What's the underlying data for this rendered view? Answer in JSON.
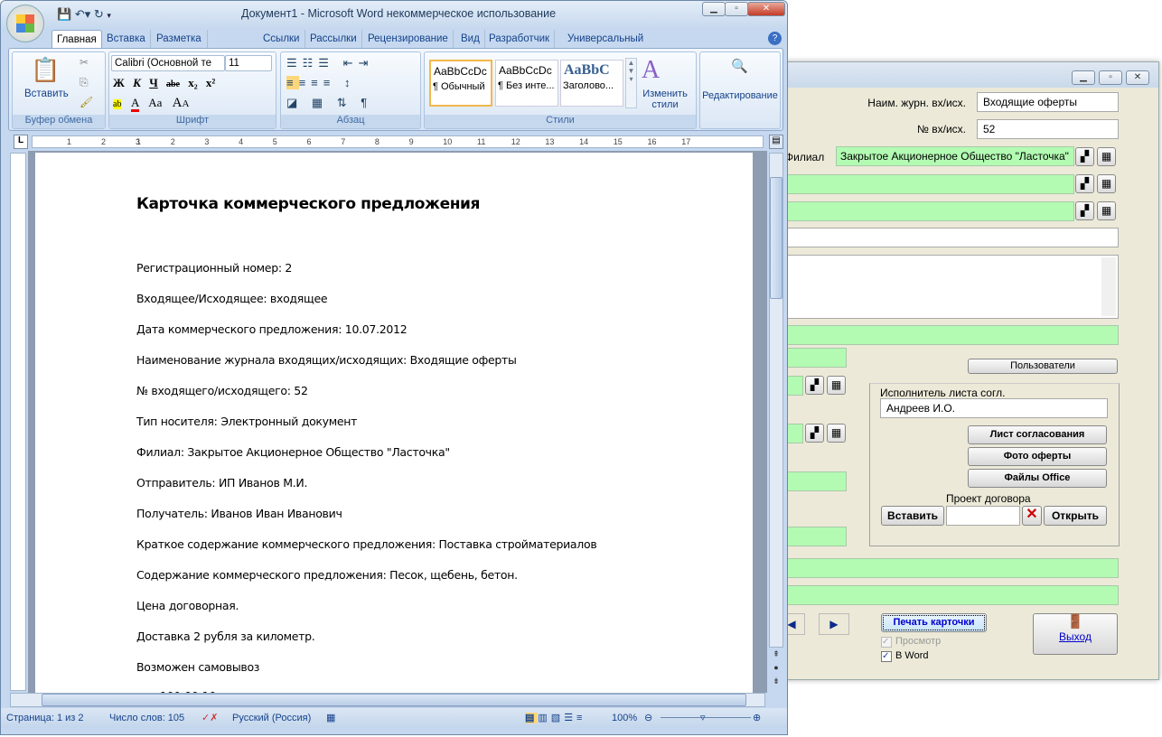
{
  "form": {
    "journal_label": "Наим. журн. вх/исх.",
    "journal_value": "Входящие оферты",
    "number_label": "№ вх/исх.",
    "number_value": "52",
    "branch_label": "Филиал",
    "branch_value": "Закрытое Акционерное Общество \"Ласточка\"",
    "users_button": "Пользователи",
    "executor_label": "Исполнитель листа согл.",
    "executor_value": "Андреев И.О.",
    "approval_sheet_button": "Лист согласования",
    "photo_button": "Фото оферты",
    "office_files_button": "Файлы Office",
    "draft_contract_label": "Проект договора",
    "insert_button": "Вставить",
    "open_button": "Открыть",
    "print_card_button": "Печать карточки",
    "preview_label": "Просмотр",
    "preview_checked": true,
    "in_word_label": "В Word",
    "in_word_checked": true,
    "exit_button": "Выход",
    "field_color": "#b3fbb3"
  },
  "word": {
    "title": "Документ1 - Microsoft Word некоммерческое использование",
    "tabs": [
      "Главная",
      "Вставка",
      "Разметка страницы",
      "Ссылки",
      "Рассылки",
      "Рецензирование",
      "Вид",
      "Разработчик",
      "Универсальный конвертер документов"
    ],
    "ribbon": {
      "paste": "Вставить",
      "clipboard": "Буфер обмена",
      "font_name": "Calibri (Основной те",
      "font_size": "11",
      "font": "Шрифт",
      "bold": "Ж",
      "italic": "К",
      "underline": "Ч",
      "strike": "abe",
      "sub": "x₂",
      "sup": "x²",
      "grow": "A",
      "shrink": "A",
      "case": "Aa",
      "paragraph": "Абзац",
      "styles": [
        {
          "preview": "AaBbCcDc",
          "name": "¶ Обычный"
        },
        {
          "preview": "AaBbCcDc",
          "name": "¶ Без инте..."
        },
        {
          "preview": "AaBbC",
          "name": "Заголово..."
        }
      ],
      "change_styles": "Изменить стили",
      "styles_group": "Стили",
      "editing": "Редактирование"
    },
    "ruler_numbers": [
      "3",
      "2",
      "1",
      "1",
      "2",
      "3",
      "4",
      "5",
      "6",
      "7",
      "8",
      "9",
      "10",
      "11",
      "12",
      "13",
      "14",
      "15",
      "16",
      "17"
    ],
    "document": {
      "heading": "Карточка коммерческого предложения",
      "lines": [
        "Регистрационный номер:  2",
        "Входящее/Исходящее:  входящее",
        "Дата коммерческого предложения: 10.07.2012",
        "Наименование журнала входящих/исходящих: Входящие оферты",
        "№ входящего/исходящего: 52",
        "Тип носителя: Электронный документ",
        "Филиал: Закрытое Акционерное Общество \"Ласточка\"",
        "Отправитель: ИП Иванов М.И.",
        "Получатель: Иванов Иван Иванович",
        "Краткое содержание коммерческого предложения: Поставка стройматериалов",
        "Содержание коммерческого предложения: Песок, щебень, бетон.",
        "Цена договорная.",
        "Доставка 2 рубля за  километр.",
        "Возможен самовывоз"
      ]
    },
    "status": {
      "page": "Страница: 1 из 2",
      "words": "Число слов: 105",
      "language": "Русский (Россия)",
      "zoom": "100%"
    }
  }
}
